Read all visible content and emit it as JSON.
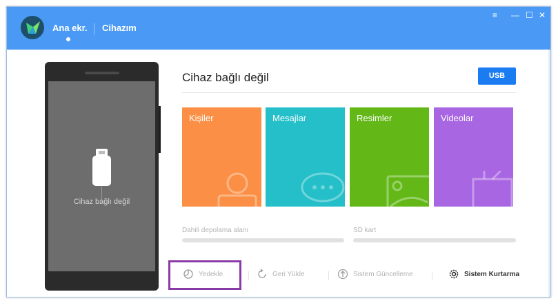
{
  "header": {
    "nav_home": "Ana ekr.",
    "nav_device": "Cihazım"
  },
  "phone": {
    "status_text": "Cihaz bağlı değil"
  },
  "main": {
    "title": "Cihaz bağlı değil",
    "usb_button": "USB",
    "tiles": [
      {
        "label": "Kişiler",
        "color": "#fb8f46",
        "icon": "person-icon"
      },
      {
        "label": "Mesajlar",
        "color": "#24bfc8",
        "icon": "chat-icon"
      },
      {
        "label": "Resimler",
        "color": "#63b818",
        "icon": "image-icon"
      },
      {
        "label": "Videolar",
        "color": "#a866e2",
        "icon": "video-icon"
      }
    ],
    "storage": {
      "internal_label": "Dahili depolama alanı",
      "sd_label": "SD kart"
    },
    "actions": {
      "backup": "Yedekle",
      "restore": "Geri Yükle",
      "update": "Sistem Güncelleme",
      "recovery": "Sistem Kurtarma"
    }
  },
  "colors": {
    "header": "#4a9af5",
    "accent": "#1a7cf0",
    "highlight": "#8a3aa6"
  }
}
